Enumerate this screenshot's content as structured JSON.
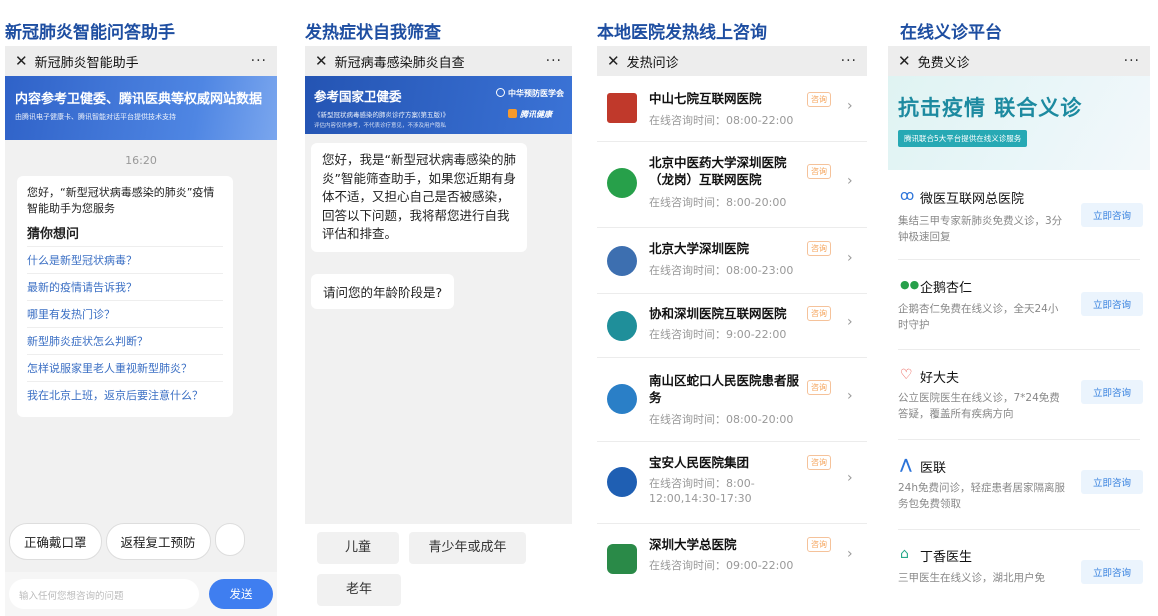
{
  "panel1": {
    "section_title": "新冠肺炎智能问答助手",
    "nav_title": "新冠肺炎智能助手",
    "banner_title": "内容参考卫健委、腾讯医典等权威网站数据",
    "banner_sub": "由腾讯电子健康卡、腾讯智能对话平台提供技术支持",
    "time": "16:20",
    "intro": "您好，“新型冠状病毒感染的肺炎”疫情智能助手为您服务",
    "guess_title": "猜你想问",
    "questions": [
      "什么是新型冠状病毒？",
      "最新的疫情请告诉我？",
      "哪里有发热门诊？",
      "新型肺炎症状怎么判断？",
      "怎样说服家里老人重视新型肺炎？",
      "我在北京上班，返京后要注意什么？"
    ],
    "chips": [
      "正确戴口罩",
      "返程复工预防"
    ],
    "input_placeholder": "输入任何您想咨询的问题",
    "send_label": "发送"
  },
  "panel2": {
    "section_title": "发热症状自我筛查",
    "nav_title": "新冠病毒感染肺炎自查",
    "banner_title": "参考国家卫健委",
    "banner_sub": "《新型冠状病毒感染的肺炎诊疗方案(第五版)》",
    "banner_note": "评估内容仅供参考，不代表诊疗意见，不涉及用户隐私",
    "logo_a": "中华预防医学会",
    "logo_b": "腾讯健康",
    "message1": "您好，我是“新型冠状病毒感染的肺炎”智能筛查助手，如果您近期有身体不适，又担心自己是否被感染，回答以下问题，我将帮您进行自我评估和排查。",
    "message2": "请问您的年龄阶段是?",
    "options": [
      "儿童",
      "青少年或成年",
      "老年"
    ]
  },
  "panel3": {
    "section_title": "本地医院发热线上咨询",
    "nav_title": "发热问诊",
    "tag": "咨询",
    "hospitals": [
      {
        "name": "中山七院互联网医院",
        "hours": "在线咨询时间：08:00-22:00",
        "color": "#c0392b"
      },
      {
        "name": "北京中医药大学深圳医院（龙岗）互联网医院",
        "hours": "在线咨询时间：8:00-20:00",
        "color": "#27a04a"
      },
      {
        "name": "北京大学深圳医院",
        "hours": "在线咨询时间：08:00-23:00",
        "color": "#3d6fb0"
      },
      {
        "name": "协和深圳医院互联网医院",
        "hours": "在线咨询时间：9:00-22:00",
        "color": "#1f8f9a"
      },
      {
        "name": "南山区蛇口人民医院患者服务",
        "hours": "在线咨询时间：08:00-20:00",
        "color": "#2a7fc7"
      },
      {
        "name": "宝安人民医院集团",
        "hours": "在线咨询时间：8:00-12:00,14:30-17:30",
        "color": "#1f5fb3"
      },
      {
        "name": "深圳大学总医院",
        "hours": "在线咨询时间：09:00-22:00",
        "color": "#2a8a48"
      }
    ]
  },
  "panel4": {
    "section_title": "在线义诊平台",
    "nav_title": "免费义诊",
    "banner_title": "抗击疫情 联合义诊",
    "banner_sub": "腾讯联合5大平台提供在线义诊服务",
    "button_label": "立即咨询",
    "platforms": [
      {
        "name": "微医互联网总医院",
        "desc": "集结三甲专家新肺炎免费义诊，3分钟极速回复",
        "icon": "ge",
        "color": "#2b73d9"
      },
      {
        "name": "企鹅杏仁",
        "desc": "企鹅杏仁免费在线义诊，全天24小时守护",
        "icon": "●●",
        "color": "#27a04a"
      },
      {
        "name": "好大夫",
        "desc": "公立医院医生在线义诊，7*24免费答疑，覆盖所有疾病方向",
        "icon": "◐",
        "color": "#e8443a"
      },
      {
        "name": "医联",
        "desc": "24h免费问诊，轻症患者居家隔离服务包免费领取",
        "icon": "⋀⋀",
        "color": "#2b73d9"
      },
      {
        "name": "丁香医生",
        "desc": "三甲医生在线义诊，湖北用户免",
        "icon": "⌂",
        "color": "#27a98a"
      }
    ]
  }
}
